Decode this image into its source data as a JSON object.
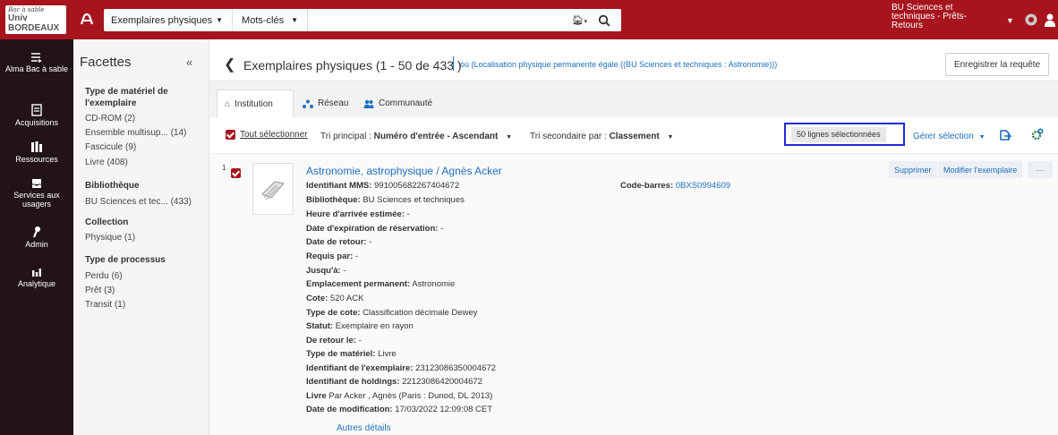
{
  "topbar": {
    "logo_top": "Bac à sable",
    "logo_main": "Univ BORDEAUX",
    "search_scope": "Exemplaires physiques",
    "search_field": "Mots-clés",
    "search_value": "",
    "user_location": "BU Sciences et techniques - Prêts-Retours"
  },
  "leftnav": {
    "items": [
      {
        "label": "Alma Bac à sable",
        "icon": "arrow-menu-icon"
      },
      {
        "label": "Acquisitions",
        "icon": "receipt-icon"
      },
      {
        "label": "Ressources",
        "icon": "books-icon"
      },
      {
        "label": "Services aux usagers",
        "icon": "inbox-icon"
      },
      {
        "label": "Admin",
        "icon": "wrench-icon"
      },
      {
        "label": "Analytique",
        "icon": "bar-chart-icon"
      }
    ]
  },
  "facets": {
    "title": "Facettes",
    "collapse": "«",
    "groups": [
      {
        "title": "Type de matériel de l'exemplaire",
        "values": [
          "CD-ROM (2)",
          "Ensemble multisup...  (14)",
          "Fascicule (9)",
          "Livre (408)"
        ]
      },
      {
        "title": "Bibliothèque",
        "values": [
          "BU Sciences et tec...  (433)"
        ]
      },
      {
        "title": "Collection",
        "values": [
          "Physique (1)"
        ]
      },
      {
        "title": "Type de processus",
        "values": [
          "Perdu (6)",
          "Prêt (3)",
          "Transit (1)"
        ]
      }
    ]
  },
  "results": {
    "title": "Exemplaires physiques (1 - 50 de 433 )",
    "condition": "où (Localisation physique permanente égale ((BU Sciences et techniques : Astronomie)))",
    "save_query": "Enregistrer la requête"
  },
  "tabs": [
    {
      "label": "Institution",
      "icon": "home-icon"
    },
    {
      "label": "Réseau",
      "icon": "network-icon"
    },
    {
      "label": "Communauté",
      "icon": "community-icon"
    }
  ],
  "toolbar": {
    "select_all": "Tout sélectionner",
    "sort_primary_label": "Tri principal :",
    "sort_primary_value": "Numéro d'entrée - Ascendant",
    "sort_secondary_label": "Tri secondaire par :",
    "sort_secondary_value": "Classement",
    "selected_count": "50 lignes sélectionnées",
    "manage_selection": "Gérer sélection"
  },
  "item": {
    "row_number": "1",
    "title": "Astronomie, astrophysique / Agnès Acker",
    "barcode_label": "Code-barres:",
    "barcode_value": "0BXS0994609",
    "actions": {
      "delete": "Supprimer",
      "edit": "Modifier l'exemplaire",
      "more": "···"
    },
    "fields": [
      {
        "label": "Identifiant MMS:",
        "value": " 991005682267404672"
      },
      {
        "label": "Bibliothèque:",
        "value": " BU Sciences et techniques"
      },
      {
        "label": "Heure d'arrivée estimée:",
        "value": " -"
      },
      {
        "label": "Date d'expiration de réservation:",
        "value": " -"
      },
      {
        "label": "Date de retour:",
        "value": " -"
      },
      {
        "label": "Requis par:",
        "value": " -"
      },
      {
        "label": "Jusqu'à:",
        "value": " -"
      },
      {
        "label": "Emplacement permanent:",
        "value": " Astronomie"
      },
      {
        "label": "Cote:",
        "value": " 520 ACK"
      },
      {
        "label": "Type de cote:",
        "value": " Classification décimale Dewey"
      },
      {
        "label": "Statut:",
        "value": " Exemplaire en rayon"
      },
      {
        "label": "De retour le:",
        "value": " -"
      },
      {
        "label": "Type de matériel:",
        "value": " Livre"
      },
      {
        "label": "Identifiant de l'exemplaire:",
        "value": " 23123086350004672"
      },
      {
        "label": "Identifiant de holdings:",
        "value": " 22123086420004672"
      },
      {
        "label": "Livre",
        "value": " Par Acker , Agnès (Paris : Dunod, DL 2013)"
      },
      {
        "label": "Date de modification:",
        "value": " 17/03/2022 12:09:08 CET"
      }
    ],
    "more_details": "Autres détails"
  },
  "colors": {
    "brand": "#a6151e",
    "nav": "#221416",
    "link": "#1f6fbf",
    "highlight_frame": "#1b2bd6"
  }
}
